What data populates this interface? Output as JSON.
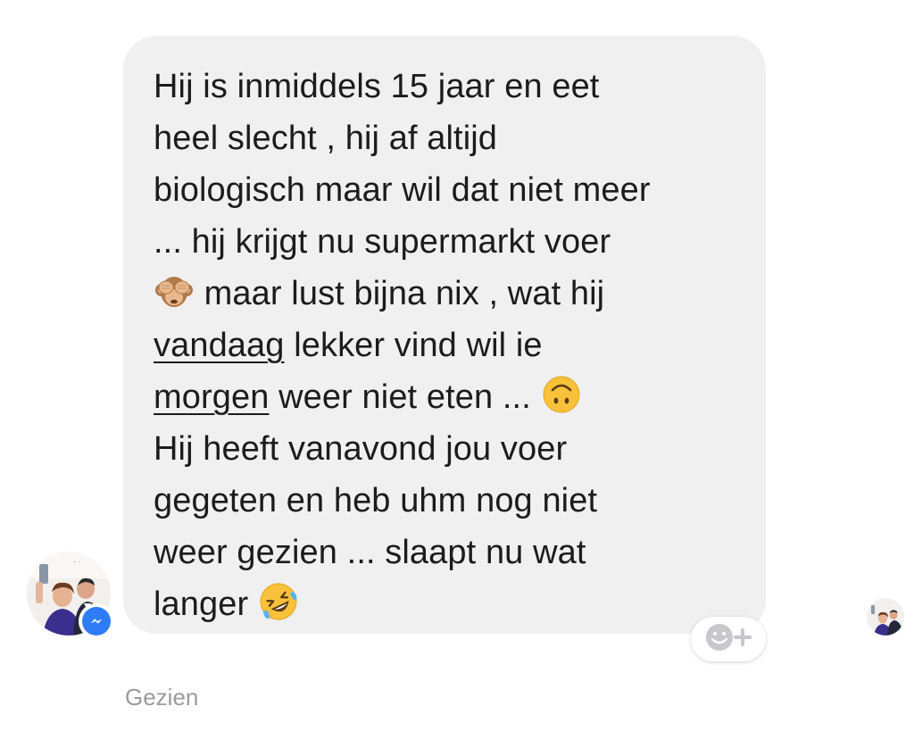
{
  "message": {
    "lines": [
      "Hij is inmiddels 15 jaar en eet",
      "heel slecht , hij af altijd",
      "biologisch maar wil dat niet meer",
      "... hij krijgt nu supermarkt voer",
      "maar lust bijna nix , wat hij",
      "lekker vind wil ie",
      "weer niet eten ...",
      "Hij heeft vanavond jou voer",
      "gegeten en heb uhm nog niet",
      "weer gezien ... slaapt nu wat",
      "langer"
    ],
    "underlined": [
      "vandaag",
      "morgen"
    ],
    "emojis": [
      "see-no-evil-monkey-emoji",
      "upside-down-face-emoji",
      "rolling-on-floor-laughing-emoji"
    ]
  },
  "status": {
    "seen_label": "Gezien"
  },
  "icons": {
    "badge": "messenger-icon",
    "reaction": "add-reaction-icon"
  },
  "colors": {
    "bubble": "#f0f0f0",
    "text": "#1c1c1e",
    "messenger_blue": "#2e7cf6",
    "seen_text": "#9b9b9b"
  }
}
